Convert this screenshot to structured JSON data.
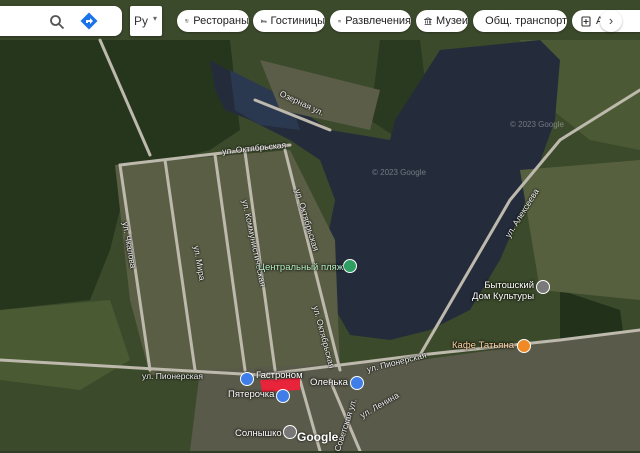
{
  "search": {
    "placeholder": ""
  },
  "layers": {
    "label": "Ру"
  },
  "categories": [
    {
      "label": "Рестораны",
      "icon": "fork-knife-icon"
    },
    {
      "label": "Гостиницы",
      "icon": "bed-icon"
    },
    {
      "label": "Развлечения",
      "icon": "camera-icon"
    },
    {
      "label": "Музеи",
      "icon": "museum-icon"
    },
    {
      "label": "Общ. транспорт",
      "icon": "bus-icon"
    },
    {
      "label": "Апте",
      "icon": "pharmacy-icon"
    }
  ],
  "streets": {
    "ozernaya": "Озерная ул.",
    "oktyabrskaya_top": "ул. Октябрьская",
    "chkalova": "ул. Чкалова",
    "mira": "ул. Мира",
    "kommunisticheskaya": "ул. Коммунистическая",
    "oktyabrskaya_side": "ул. Октябрьская",
    "oktyabrskaya_south": "ул. Октябрьская",
    "pionerskaya_west": "ул. Пионерская",
    "pionerskaya_east": "ул. Пионерская",
    "alekseeva": "ул. Алексеева",
    "lenina": "ул. Ленина",
    "sovetskaya": "Советская ул."
  },
  "pois": {
    "beach": "Центральный пляж",
    "culture_house": "Бытошский\nДом Культуры",
    "cafe": "Кафе Татьяна",
    "gastronom": "Гастроном",
    "olenka": "Оленька",
    "pyaterochka": "Пятерочка",
    "solnyshko": "Солнышко"
  },
  "copyright": "© 2023 Google",
  "logo": "Google"
}
